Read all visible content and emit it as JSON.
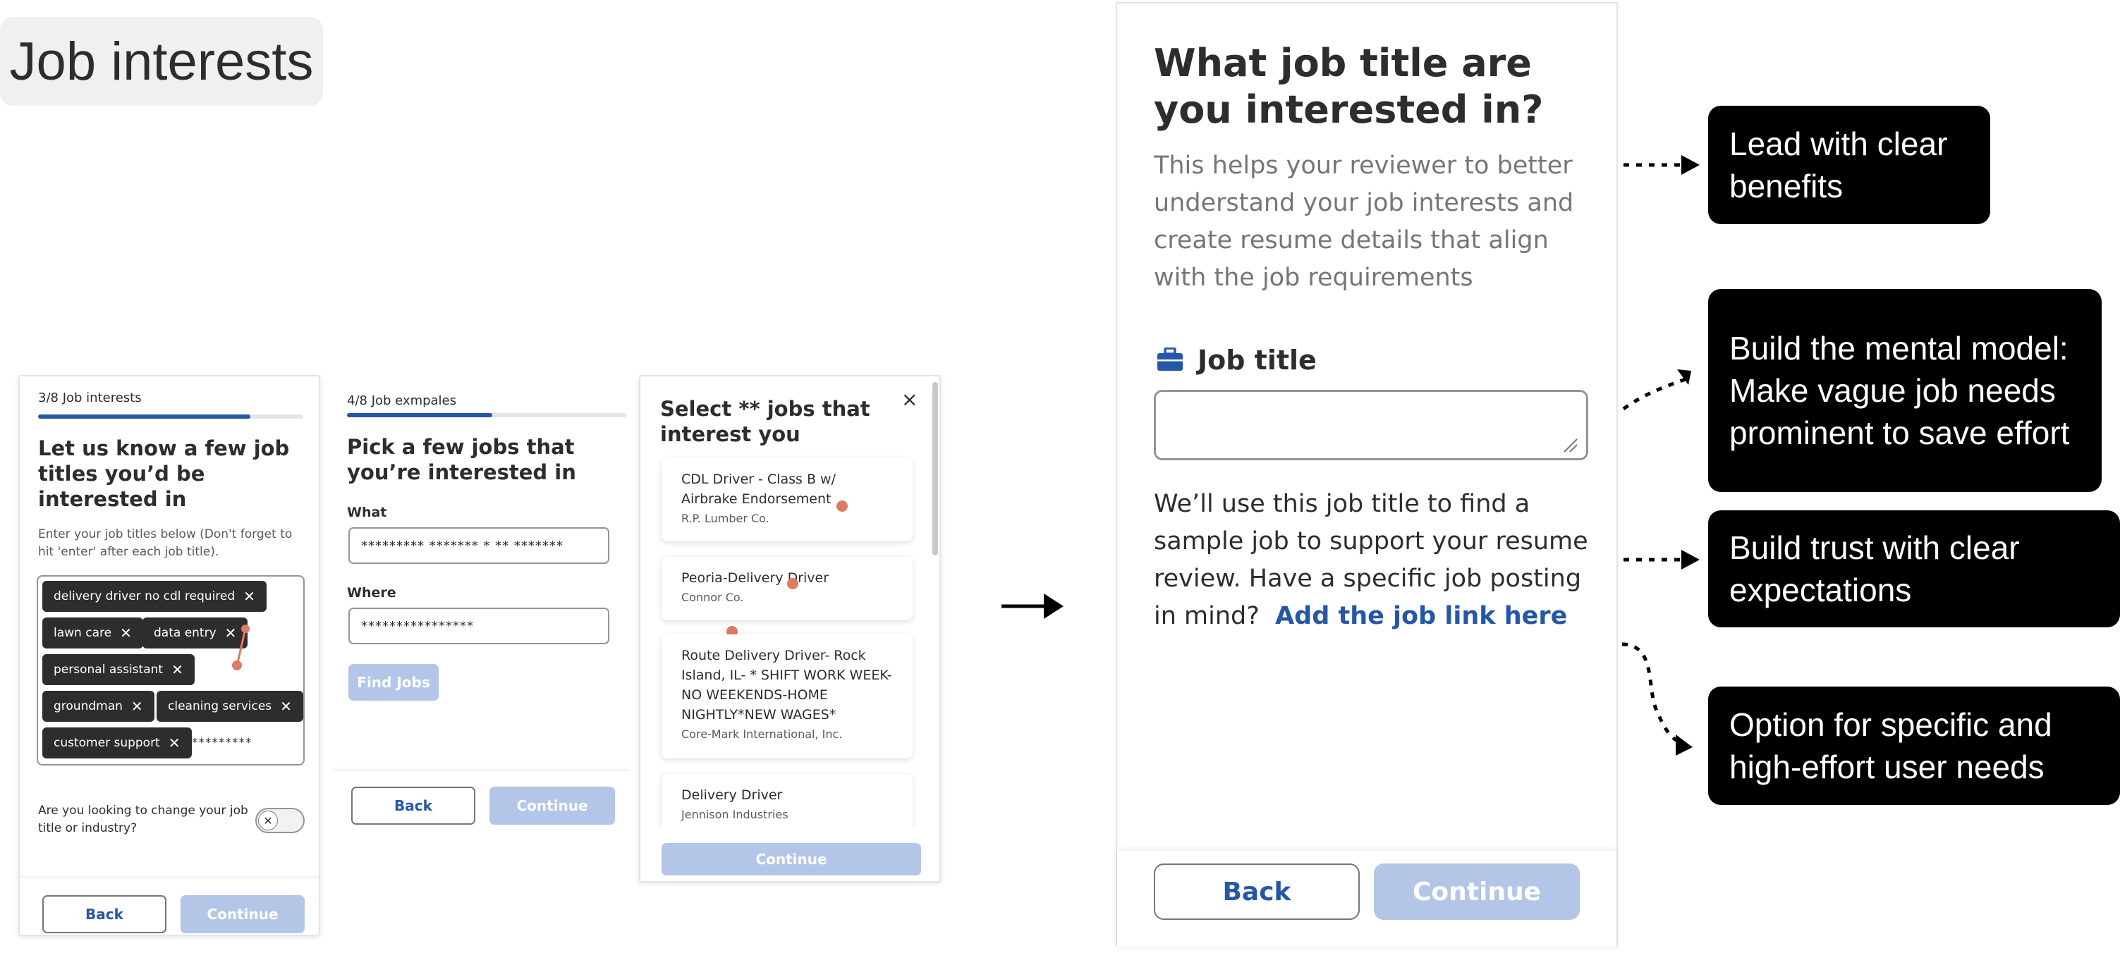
{
  "page_title": "Job interests",
  "screen1": {
    "progress_label": "3/8 Job interests",
    "progress": 0.8,
    "heading": "Let us know a few job titles you’d be interested in",
    "helper": "Enter your job titles below (Don't forget to hit 'enter' after each job title).",
    "chips": [
      "delivery driver no cdl required",
      "lawn care",
      "data entry",
      "personal assistant",
      "groundman",
      "cleaning services",
      "customer support"
    ],
    "chip_input_value": "*********",
    "toggle_question": "Are you looking to change your job title or industry?",
    "toggle_icon": "close-icon",
    "back_label": "Back",
    "continue_label": "Continue"
  },
  "screen2": {
    "progress_label": "4/8 Job exmpales",
    "progress": 0.52,
    "heading": "Pick a few jobs that you’re interested in",
    "what_label": "What",
    "what_value": "********* ******* * ** *******",
    "where_label": "Where",
    "where_value": "****************",
    "find_jobs_label": "Find Jobs",
    "back_label": "Back",
    "continue_label": "Continue"
  },
  "screen3": {
    "heading": "Select ** jobs that interest you",
    "close_icon": "×",
    "jobs": [
      {
        "title": "CDL Driver - Class B w/ Airbrake Endorsement",
        "company": "R.P. Lumber Co."
      },
      {
        "title": "Peoria-Delivery Driver",
        "company": "Connor Co."
      },
      {
        "title": "Route Delivery Driver- Rock Island, IL- * SHIFT WORK WEEK- NO WEEKENDS-HOME NIGHTLY*NEW WAGES*",
        "company": "Core-Mark International, Inc."
      },
      {
        "title": "Delivery Driver",
        "company": "Jennison Industries"
      }
    ],
    "continue_label": "Continue"
  },
  "big_screen": {
    "heading": "What job title are you interested in?",
    "subtitle": "This helps your reviewer to better understand your job interests and create resume details that align with the job requirements",
    "field_label": "Job title",
    "field_icon": "briefcase-icon",
    "field_value": "",
    "info_text": "We’ll use this job title to find a sample job to support your resume review. Have a specific job posting in mind?",
    "link_text": "Add the job link here",
    "back_label": "Back",
    "continue_label": "Continue"
  },
  "annotations": [
    "Lead with clear benefits",
    "Build the mental model: Make vague job needs prominent to save effort",
    "Build trust with clear expectations",
    "Option for specific and high-effort user needs"
  ],
  "colors": {
    "primary_blue": "#2557a7",
    "disabled_blue": "#b4c6e7",
    "chip_dark": "#2d2d2d",
    "annotation_bg": "#000000",
    "marker_dot": "#e07b63"
  }
}
